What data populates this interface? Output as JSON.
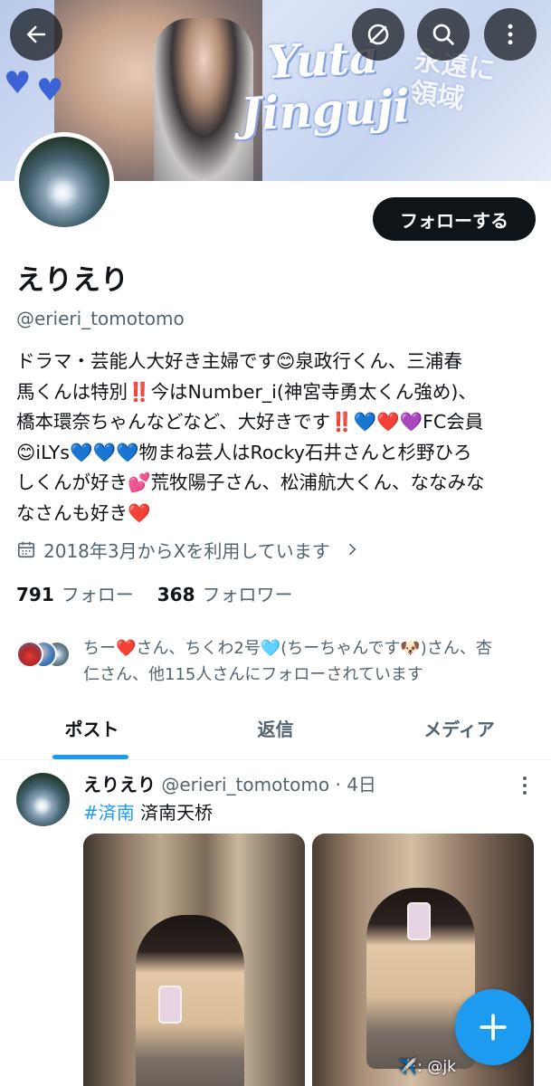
{
  "banner": {
    "title_line1": "Yuta",
    "title_line2": "Jinguji",
    "kanji_line1": "永遠に",
    "kanji_line2": "領域"
  },
  "toolbar": {
    "back_icon": "arrow-left-icon",
    "unmute_icon": "bell-off-icon",
    "search_icon": "search-icon",
    "more_icon": "more-vertical-icon"
  },
  "profile": {
    "name": "えりえり",
    "handle": "@erieri_tomotomo",
    "follow_label": "フォローする",
    "bio_lines": [
      "ドラマ・芸能人大好き主婦です😊泉政行くん、三浦春",
      "馬くんは特別‼️今はNumber_i(神宮寺勇太くん強め)、",
      "橋本環奈ちゃんなどなど、大好きです‼️💙❤️💜FC会員",
      "😊iLYs💙💙💙物まね芸人はRocky石井さんと杉野ひろ",
      "しくんが好き💕荒牧陽子さん、松浦航大くん、ななみな",
      "なさんも好き❤️"
    ],
    "joined": "2018年3月からXを利用しています",
    "following_count": "791",
    "following_label": "フォロー",
    "followers_count": "368",
    "followers_label": "フォロワー",
    "followed_by_lines": [
      "ちー❤️さん、ちくわ2号🩵(ちーちゃんです🐶)さん、杏",
      "仁さん、他115人さんにフォローされています"
    ]
  },
  "tabs": [
    {
      "label": "ポスト",
      "active": true
    },
    {
      "label": "返信",
      "active": false
    },
    {
      "label": "メディア",
      "active": false
    }
  ],
  "post": {
    "author": "えりえり",
    "handle": "@erieri_tomotomo",
    "time": "· 4日",
    "hashtag": "#済南",
    "text": "済南天桥",
    "image_caption": "✈️: @jk"
  },
  "fab": {
    "label": "+",
    "icon": "plus-icon"
  },
  "colors": {
    "accent": "#1d9bf0",
    "text": "#0f1419",
    "secondary": "#536471",
    "follow_button": "#0f1419"
  }
}
